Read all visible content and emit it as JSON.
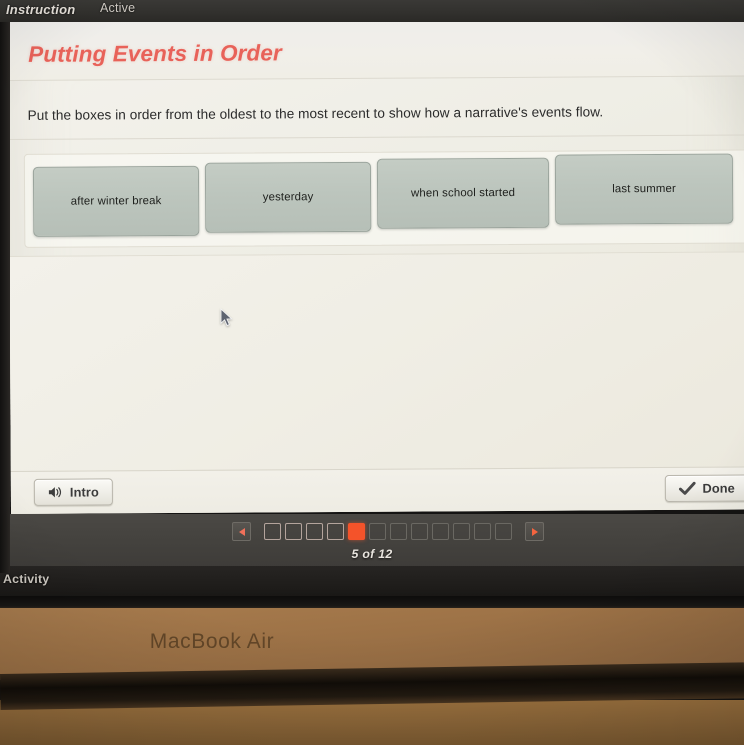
{
  "os_bar": {
    "instruction_label": "Instruction",
    "active_label": "Active"
  },
  "activity_bar": {
    "label": "Activity"
  },
  "lesson": {
    "title": "Putting Events in Order",
    "title_color": "#e86259",
    "prompt": "Put the boxes in order from the oldest to the most recent to show how a narrative's events flow.",
    "tiles": [
      {
        "label": "after winter break"
      },
      {
        "label": "yesterday"
      },
      {
        "label": "when school started"
      },
      {
        "label": "last summer"
      }
    ]
  },
  "toolbar": {
    "intro_label": "Intro",
    "intro_icon": "speaker-icon",
    "done_label": "Done",
    "done_icon": "check-icon"
  },
  "pager": {
    "prev_icon": "chevron-left-icon",
    "next_icon": "chevron-right-icon",
    "total": 12,
    "current": 5,
    "count_label": "5 of 12",
    "active_color": "#f4532a"
  },
  "device": {
    "brand": "MacBook Air"
  }
}
